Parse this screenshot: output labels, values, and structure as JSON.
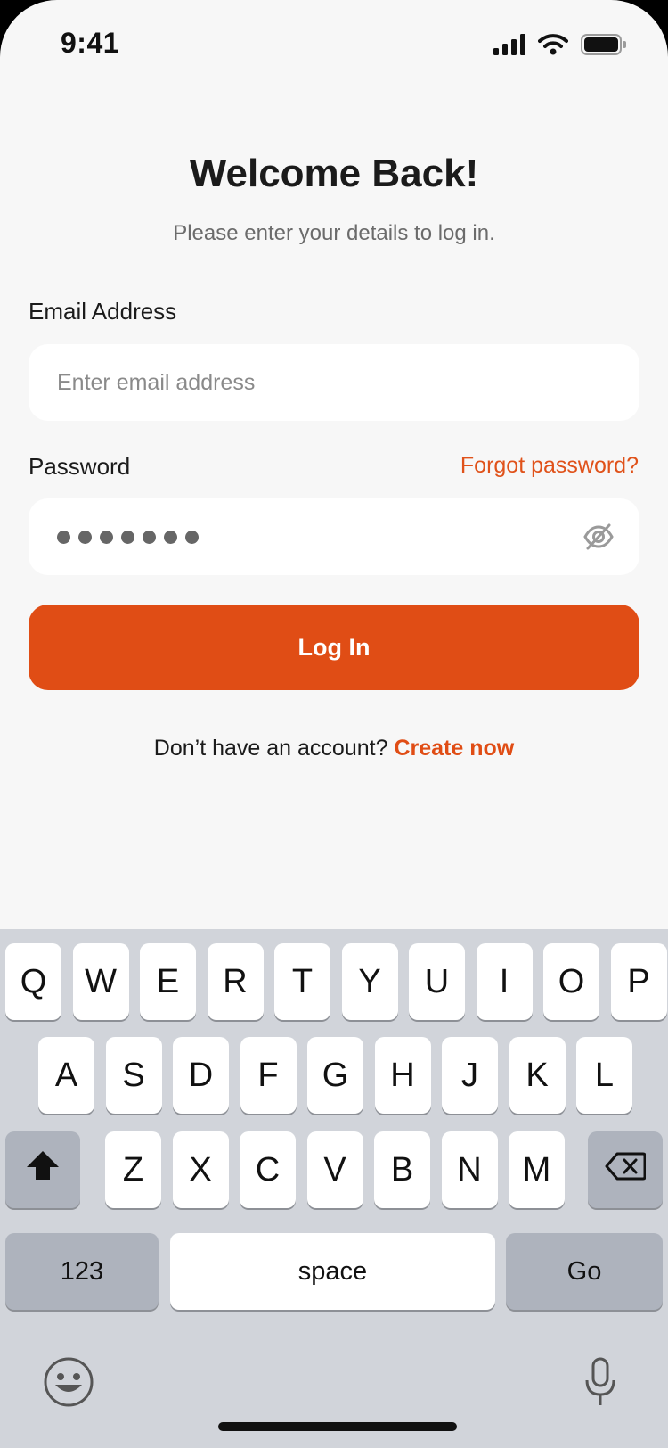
{
  "status_bar": {
    "time": "9:41"
  },
  "header": {
    "title": "Welcome Back!",
    "subtitle": "Please enter your details to log in."
  },
  "form": {
    "email_label": "Email Address",
    "email_placeholder": "Enter email address",
    "password_label": "Password",
    "forgot_password": "Forgot password?",
    "password_dots": 7,
    "login_button": "Log In"
  },
  "signup": {
    "prompt": "Don’t have an account?",
    "link": "Create now"
  },
  "keyboard": {
    "row1": [
      "Q",
      "W",
      "E",
      "R",
      "T",
      "Y",
      "U",
      "I",
      "O",
      "P"
    ],
    "row2": [
      "A",
      "S",
      "D",
      "F",
      "G",
      "H",
      "J",
      "K",
      "L"
    ],
    "row3": [
      "Z",
      "X",
      "C",
      "V",
      "B",
      "N",
      "M"
    ],
    "numbers_key": "123",
    "space_key": "space",
    "go_key": "Go"
  },
  "colors": {
    "accent": "#e04d15",
    "background": "#f7f7f7",
    "keyboard_bg": "#d1d4da"
  },
  "icons": [
    "signal-icon",
    "wifi-icon",
    "battery-icon",
    "eye-off-icon",
    "shift-icon",
    "backspace-icon",
    "emoji-icon",
    "microphone-icon"
  ]
}
